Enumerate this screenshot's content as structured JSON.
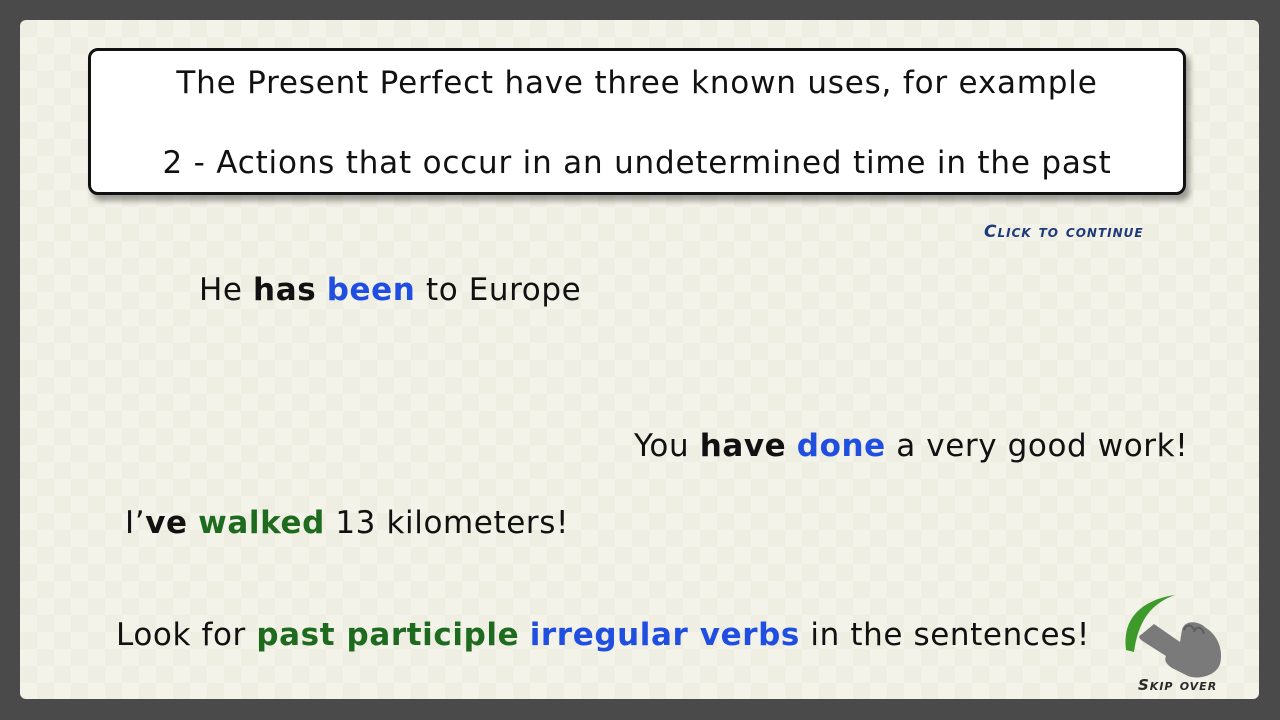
{
  "title": {
    "line1": "The Present Perfect have three known uses, for example",
    "line2": "2 - Actions that occur in an undetermined time in the past"
  },
  "continue_label": "Click to continue",
  "sentences": {
    "s1": {
      "a": "He ",
      "b": "has",
      "c": " ",
      "d": "been",
      "e": " to Europe"
    },
    "s2": {
      "a": "You ",
      "b": "have",
      "c": " ",
      "d": "done",
      "e": " a very good work!"
    },
    "s3": {
      "a": "I’",
      "b": "ve",
      "c": " ",
      "d": "walked",
      "e": " 13 kilometers!"
    },
    "s4": {
      "a": "Look for ",
      "b": "past participle",
      "c": " ",
      "d": "irregular verbs",
      "e": " in the sentences!"
    }
  },
  "skip": {
    "label": "Skip over",
    "icon": "hand-pointer-icon"
  },
  "colors": {
    "accent_blue": "#1f4ee0",
    "accent_green": "#1e6a1e",
    "continue_text": "#1e3a7a"
  }
}
